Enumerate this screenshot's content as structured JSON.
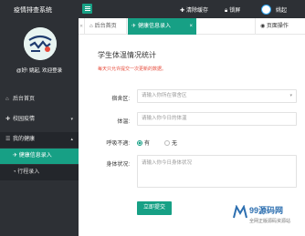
{
  "header": {
    "app_title": "疫情排查系统",
    "clear_cache": "清除缓存",
    "lock_screen": "锁屏",
    "username": "姚起"
  },
  "sidebar": {
    "logo_text": "玩学爱课",
    "welcome": "@好! 姚起, 欢迎登录",
    "items": [
      {
        "label": "后台首页",
        "icon": "home-icon"
      },
      {
        "label": "校园疫情",
        "icon": "hospital-icon"
      },
      {
        "label": "我的健康",
        "icon": "user-icon"
      }
    ],
    "sub_items": [
      {
        "label": "健康信息录入",
        "icon": "send-icon"
      },
      {
        "label": "行程录入",
        "icon": "clock-icon"
      }
    ]
  },
  "tabs": {
    "home": "后台首页",
    "active": "健康信息录入",
    "page_ops": "页面操作"
  },
  "form": {
    "title": "学生体温情况统计",
    "note": "每天只允许提交一次更新的数据。",
    "dorm_label": "宿舍区:",
    "dorm_placeholder": "请输入你所在宿舍区",
    "temp_label": "体温:",
    "temp_placeholder": "请输入你今日的体温",
    "breath_label": "呼吸不適:",
    "breath_options": [
      "有",
      "无"
    ],
    "breath_selected": "有",
    "status_label": "身体状况:",
    "status_placeholder": "请输入你今日身体状况",
    "submit_label": "立即提交"
  },
  "watermark": {
    "site": "99源码网",
    "sub": "全网正版源码资源站"
  },
  "colors": {
    "sidebar_bg": "#2d3035",
    "accent": "#17a085",
    "note": "#e74c3c"
  }
}
